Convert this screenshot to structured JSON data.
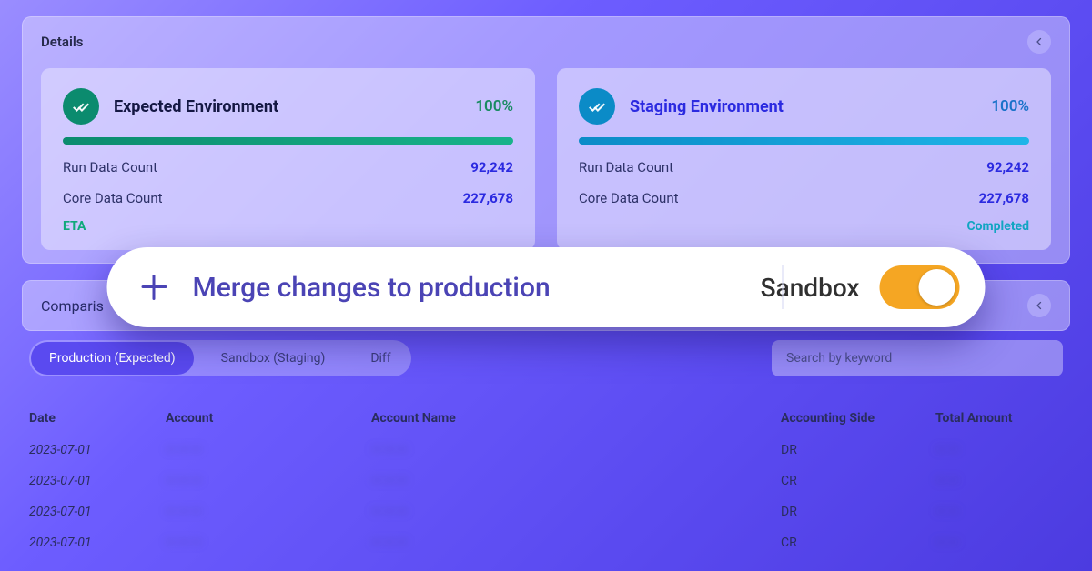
{
  "details": {
    "title": "Details",
    "cards": [
      {
        "title": "Expected Environment",
        "percent": "100%",
        "runData": {
          "label": "Run Data Count",
          "value": "92,242"
        },
        "coreData": {
          "label": "Core Data Count",
          "value": "227,678"
        },
        "eta": "ETA"
      },
      {
        "title": "Staging Environment",
        "percent": "100%",
        "runData": {
          "label": "Run Data Count",
          "value": "92,242"
        },
        "coreData": {
          "label": "Core Data Count",
          "value": "227,678"
        },
        "eta": "Completed"
      }
    ]
  },
  "comparison": {
    "title": "Comparis"
  },
  "tabs": {
    "production": "Production (Expected)",
    "sandbox": "Sandbox (Staging)",
    "diff": "Diff"
  },
  "search": {
    "placeholder": "Search by keyword"
  },
  "table": {
    "headers": {
      "date": "Date",
      "account": "Account",
      "name": "Account Name",
      "side": "Accounting Side",
      "amount": "Total Amount"
    },
    "rows": [
      {
        "date": "2023-07-01",
        "account": "— — —",
        "name": "— — —",
        "side": "DR",
        "amount": "— —"
      },
      {
        "date": "2023-07-01",
        "account": "— — —",
        "name": "— — —",
        "side": "CR",
        "amount": "— —"
      },
      {
        "date": "2023-07-01",
        "account": "— — —",
        "name": "— — —",
        "side": "DR",
        "amount": "— —"
      },
      {
        "date": "2023-07-01",
        "account": "— — —",
        "name": "— — —",
        "side": "CR",
        "amount": "— —"
      }
    ]
  },
  "dialog": {
    "merge": "Merge changes to production",
    "sandbox": "Sandbox"
  }
}
